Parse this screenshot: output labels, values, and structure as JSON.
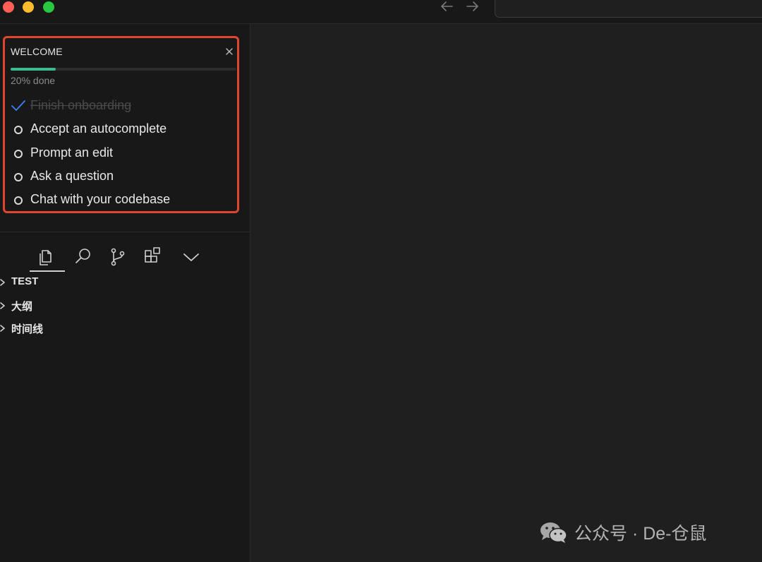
{
  "window": {
    "traffic_lights": {
      "close": "#ff5f57",
      "minimize": "#febc2e",
      "zoom": "#28c840"
    },
    "nav": {
      "back_icon": "arrow-left-icon",
      "forward_icon": "arrow-right-icon"
    }
  },
  "welcome": {
    "title": "WELCOME",
    "close_icon": "close-icon",
    "progress": 0.2,
    "progress_text": "20% done",
    "progress_color": "#3fb98f",
    "tasks": [
      {
        "label": "Finish onboarding",
        "done": true
      },
      {
        "label": "Accept an autocomplete",
        "done": false
      },
      {
        "label": "Prompt an edit",
        "done": false
      },
      {
        "label": "Ask a question",
        "done": false
      },
      {
        "label": "Chat with your codebase",
        "done": false
      }
    ],
    "highlight_color": "#e0452f"
  },
  "activity_bar": {
    "items": [
      "explorer-icon",
      "search-icon",
      "source-control-icon",
      "extensions-icon",
      "chevron-down-icon"
    ],
    "active": "explorer-icon"
  },
  "sections": [
    {
      "label": "TEST"
    },
    {
      "label": "大纲"
    },
    {
      "label": "时间线"
    }
  ],
  "watermark": {
    "text": "公众号 · De-仓鼠",
    "icon": "wechat-icon"
  }
}
